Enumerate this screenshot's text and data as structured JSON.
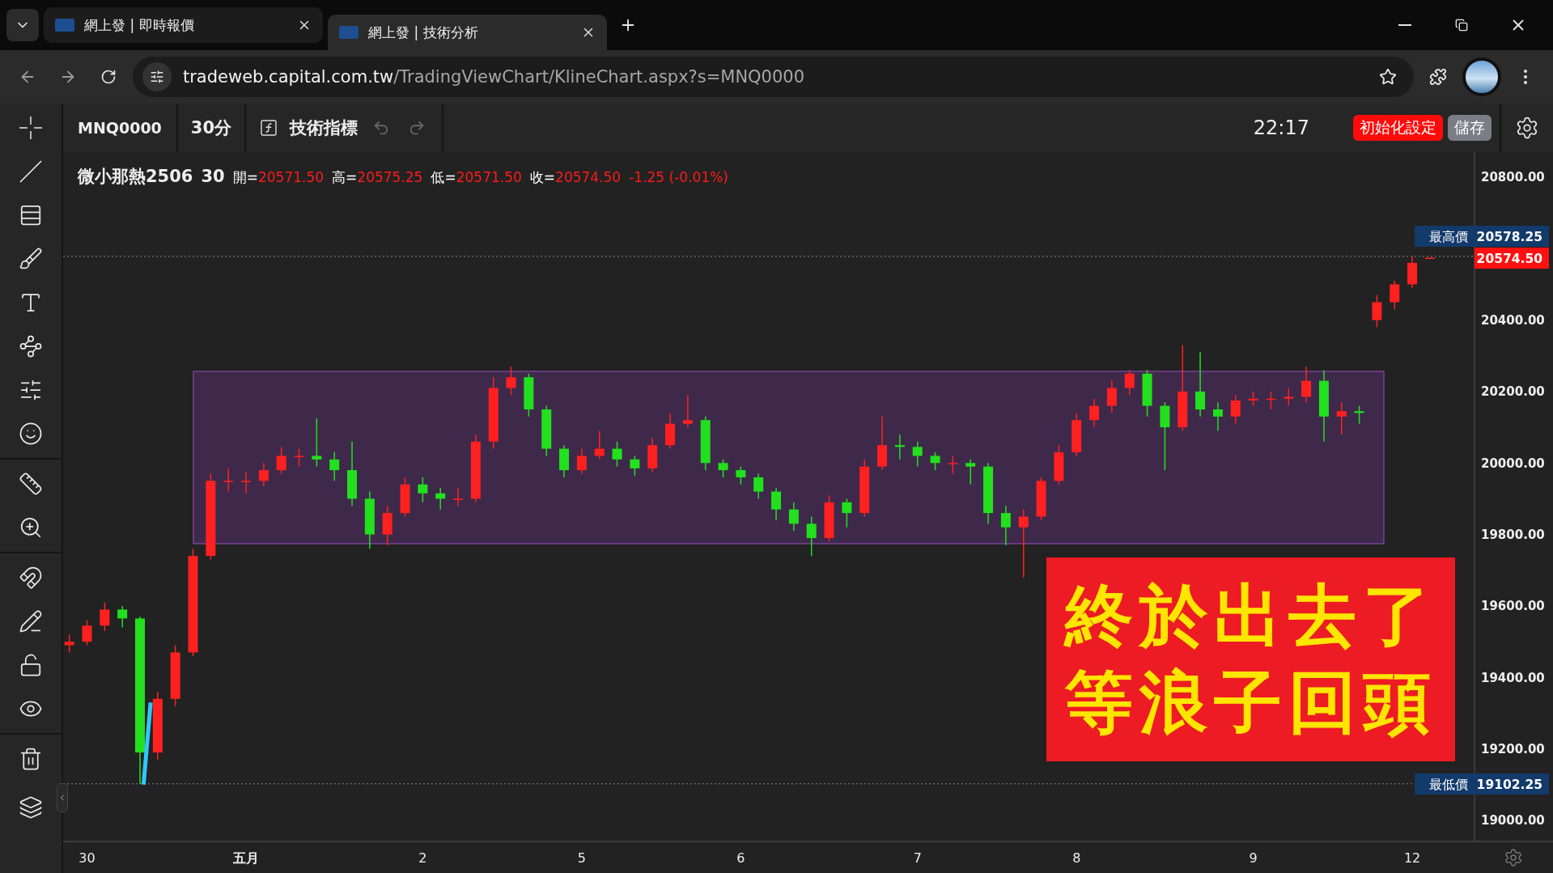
{
  "browser": {
    "tabs": [
      {
        "title": "網上發 | 即時報價",
        "selected": false
      },
      {
        "title": "網上發 | 技術分析",
        "selected": true
      }
    ],
    "address": {
      "host": "tradeweb.capital.com.tw",
      "path": "/TradingViewChart/KlineChart.aspx?s=MNQ0000"
    }
  },
  "toolbar": {
    "symbol": "MNQ0000",
    "interval": "30分",
    "indicators": "技術指標",
    "time": "22:17",
    "buttons": [
      {
        "label": "初始化設定",
        "kind": "danger"
      },
      {
        "label": "儲存",
        "kind": "neutral"
      }
    ]
  },
  "legend": {
    "name": "微小那熱2506",
    "interval": "30",
    "fields": [
      {
        "label": "開=",
        "value": "20571.50"
      },
      {
        "label": "高=",
        "value": "20575.25"
      },
      {
        "label": "低=",
        "value": "20571.50"
      },
      {
        "label": "收=",
        "value": "20574.50"
      }
    ],
    "change": "-1.25 (-0.01%)"
  },
  "chart_data": {
    "type": "candlestick",
    "ylim": [
      18941,
      20870
    ],
    "ref_lines": [
      {
        "axis": "y",
        "value": 20578.25
      },
      {
        "axis": "y",
        "value": 19102.25
      }
    ],
    "yticks": [
      {
        "value": 20800,
        "label": "20800.00"
      },
      {
        "value": 20400,
        "label": "20400.00"
      },
      {
        "value": 20200,
        "label": "20200.00"
      },
      {
        "value": 20000,
        "label": "20000.00"
      },
      {
        "value": 19800,
        "label": "19800.00"
      },
      {
        "value": 19600,
        "label": "19600.00"
      },
      {
        "value": 19400,
        "label": "19400.00"
      },
      {
        "value": 19200,
        "label": "19200.00"
      },
      {
        "value": 19000,
        "label": "19000.00"
      }
    ],
    "categories": [
      null,
      "30",
      null,
      null,
      null,
      null,
      null,
      null,
      null,
      null,
      "五月",
      null,
      null,
      null,
      null,
      null,
      null,
      null,
      null,
      null,
      "2",
      null,
      null,
      null,
      null,
      null,
      null,
      null,
      null,
      "5",
      null,
      null,
      null,
      null,
      null,
      null,
      null,
      null,
      "6",
      null,
      null,
      null,
      null,
      null,
      null,
      null,
      null,
      null,
      "7",
      null,
      null,
      null,
      null,
      null,
      null,
      null,
      null,
      "8",
      null,
      null,
      null,
      null,
      null,
      null,
      null,
      null,
      null,
      "9",
      null,
      null,
      null,
      null,
      null,
      null,
      null,
      null,
      "12",
      null
    ],
    "ohlc": [
      [
        19490,
        19520,
        19470,
        19500
      ],
      [
        19500,
        19560,
        19490,
        19545
      ],
      [
        19545,
        19610,
        19530,
        19590
      ],
      [
        19590,
        19600,
        19540,
        19565
      ],
      [
        19565,
        19570,
        19102.25,
        19190
      ],
      [
        19190,
        19360,
        19170,
        19340
      ],
      [
        19340,
        19490,
        19320,
        19470
      ],
      [
        19470,
        19760,
        19460,
        19740
      ],
      [
        19740,
        19970,
        19730,
        19950
      ],
      [
        19950,
        19985,
        19920,
        19950
      ],
      [
        19950,
        19975,
        19915,
        19950
      ],
      [
        19950,
        20000,
        19935,
        19980
      ],
      [
        19980,
        20045,
        19970,
        20020
      ],
      [
        20020,
        20040,
        19990,
        20020
      ],
      [
        20020,
        20125,
        19990,
        20010
      ],
      [
        20010,
        20030,
        19950,
        19980
      ],
      [
        19980,
        20060,
        19880,
        19900
      ],
      [
        19900,
        19920,
        19760,
        19800
      ],
      [
        19800,
        19880,
        19770,
        19860
      ],
      [
        19860,
        19960,
        19850,
        19940
      ],
      [
        19940,
        19960,
        19890,
        19915
      ],
      [
        19915,
        19930,
        19870,
        19900
      ],
      [
        19900,
        19930,
        19880,
        19900
      ],
      [
        19900,
        20080,
        19890,
        20060
      ],
      [
        20060,
        20240,
        20040,
        20210
      ],
      [
        20210,
        20270,
        20190,
        20240
      ],
      [
        20240,
        20250,
        20130,
        20150
      ],
      [
        20150,
        20160,
        20020,
        20040
      ],
      [
        20040,
        20050,
        19960,
        19980
      ],
      [
        19980,
        20040,
        19970,
        20020
      ],
      [
        20020,
        20090,
        20010,
        20040
      ],
      [
        20040,
        20060,
        19990,
        20010
      ],
      [
        20010,
        20020,
        19965,
        19985
      ],
      [
        19985,
        20070,
        19975,
        20050
      ],
      [
        20050,
        20140,
        20040,
        20110
      ],
      [
        20110,
        20190,
        20100,
        20120
      ],
      [
        20120,
        20130,
        19980,
        20000
      ],
      [
        20000,
        20010,
        19960,
        19980
      ],
      [
        19980,
        19990,
        19940,
        19960
      ],
      [
        19960,
        19970,
        19900,
        19920
      ],
      [
        19920,
        19930,
        19840,
        19870
      ],
      [
        19870,
        19890,
        19810,
        19830
      ],
      [
        19830,
        19850,
        19740,
        19790
      ],
      [
        19790,
        19910,
        19780,
        19890
      ],
      [
        19890,
        19900,
        19820,
        19860
      ],
      [
        19860,
        20010,
        19850,
        19990
      ],
      [
        19990,
        20130,
        19980,
        20050
      ],
      [
        20050,
        20080,
        20010,
        20045
      ],
      [
        20045,
        20060,
        19990,
        20020
      ],
      [
        20020,
        20030,
        19980,
        20000
      ],
      [
        20000,
        20020,
        19970,
        20000
      ],
      [
        20000,
        20010,
        19940,
        19990
      ],
      [
        19990,
        20000,
        19830,
        19860
      ],
      [
        19860,
        19880,
        19770,
        19820
      ],
      [
        19820,
        19870,
        19680,
        19850
      ],
      [
        19850,
        19960,
        19840,
        19950
      ],
      [
        19950,
        20050,
        19940,
        20030
      ],
      [
        20030,
        20140,
        20020,
        20120
      ],
      [
        20120,
        20180,
        20100,
        20160
      ],
      [
        20160,
        20230,
        20140,
        20210
      ],
      [
        20210,
        20260,
        20190,
        20250
      ],
      [
        20250,
        20260,
        20130,
        20160
      ],
      [
        20160,
        20170,
        19980,
        20100
      ],
      [
        20100,
        20330,
        20090,
        20200
      ],
      [
        20200,
        20310,
        20130,
        20150
      ],
      [
        20150,
        20170,
        20090,
        20130
      ],
      [
        20130,
        20190,
        20110,
        20175
      ],
      [
        20175,
        20200,
        20160,
        20180
      ],
      [
        20180,
        20200,
        20150,
        20180
      ],
      [
        20180,
        20210,
        20160,
        20185
      ],
      [
        20185,
        20270,
        20170,
        20230
      ],
      [
        20230,
        20260,
        20060,
        20130
      ],
      [
        20130,
        20170,
        20080,
        20145
      ],
      [
        20145,
        20160,
        20110,
        20140
      ],
      [
        20400,
        20470,
        20380,
        20450
      ],
      [
        20450,
        20510,
        20430,
        20500
      ],
      [
        20500,
        20578.25,
        20490,
        20560
      ],
      [
        20571.5,
        20575.25,
        20571.5,
        20574.5
      ]
    ]
  },
  "price_axis": {
    "high": {
      "label": "最高價",
      "value": "20578.25"
    },
    "last": {
      "value": "20574.50"
    },
    "low": {
      "label": "最低價",
      "value": "19102.25"
    }
  },
  "time_axis": [
    {
      "emphasized": false
    },
    {
      "emphasized": true
    },
    {
      "emphasized": false
    },
    {
      "emphasized": false
    },
    {
      "emphasized": false
    },
    {
      "emphasized": false
    },
    {
      "emphasized": false
    },
    {
      "emphasized": false
    },
    {
      "emphasized": false
    }
  ],
  "banner": {
    "lines": [
      "終於出去了",
      "等浪子回頭"
    ]
  }
}
